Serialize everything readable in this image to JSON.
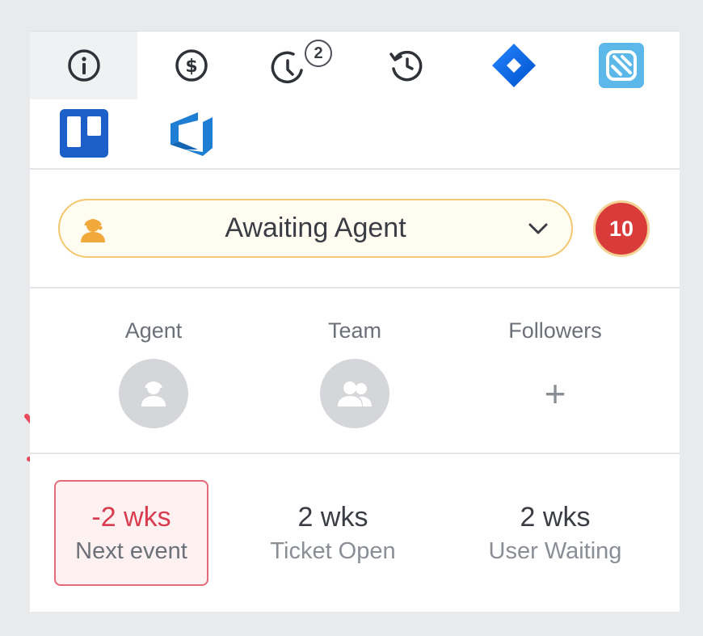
{
  "toolbar": {
    "buttons": [
      {
        "icon": "info-icon",
        "active": true
      },
      {
        "icon": "dollar-icon",
        "active": false
      },
      {
        "icon": "clock-icon",
        "active": false,
        "badge": "2"
      },
      {
        "icon": "history-icon",
        "active": false
      },
      {
        "icon": "jira-icon",
        "active": false
      },
      {
        "icon": "square-app-icon",
        "active": false
      },
      {
        "icon": "trello-icon",
        "active": false
      },
      {
        "icon": "azure-devops-icon",
        "active": false
      }
    ]
  },
  "status": {
    "label": "Awaiting Agent",
    "icon": "agent-icon",
    "count": "10",
    "accent": "#f3c76f",
    "badge_color": "#d93b3b"
  },
  "people": {
    "agent_label": "Agent",
    "team_label": "Team",
    "followers_label": "Followers",
    "add_symbol": "+"
  },
  "stats": [
    {
      "value": "-2 wks",
      "caption": "Next event",
      "highlight": true
    },
    {
      "value": "2 wks",
      "caption": "Ticket Open",
      "highlight": false
    },
    {
      "value": "2 wks",
      "caption": "User Waiting",
      "highlight": false
    }
  ],
  "colors": {
    "highlight_text": "#d83c4e",
    "arrow": "#e8495c"
  }
}
